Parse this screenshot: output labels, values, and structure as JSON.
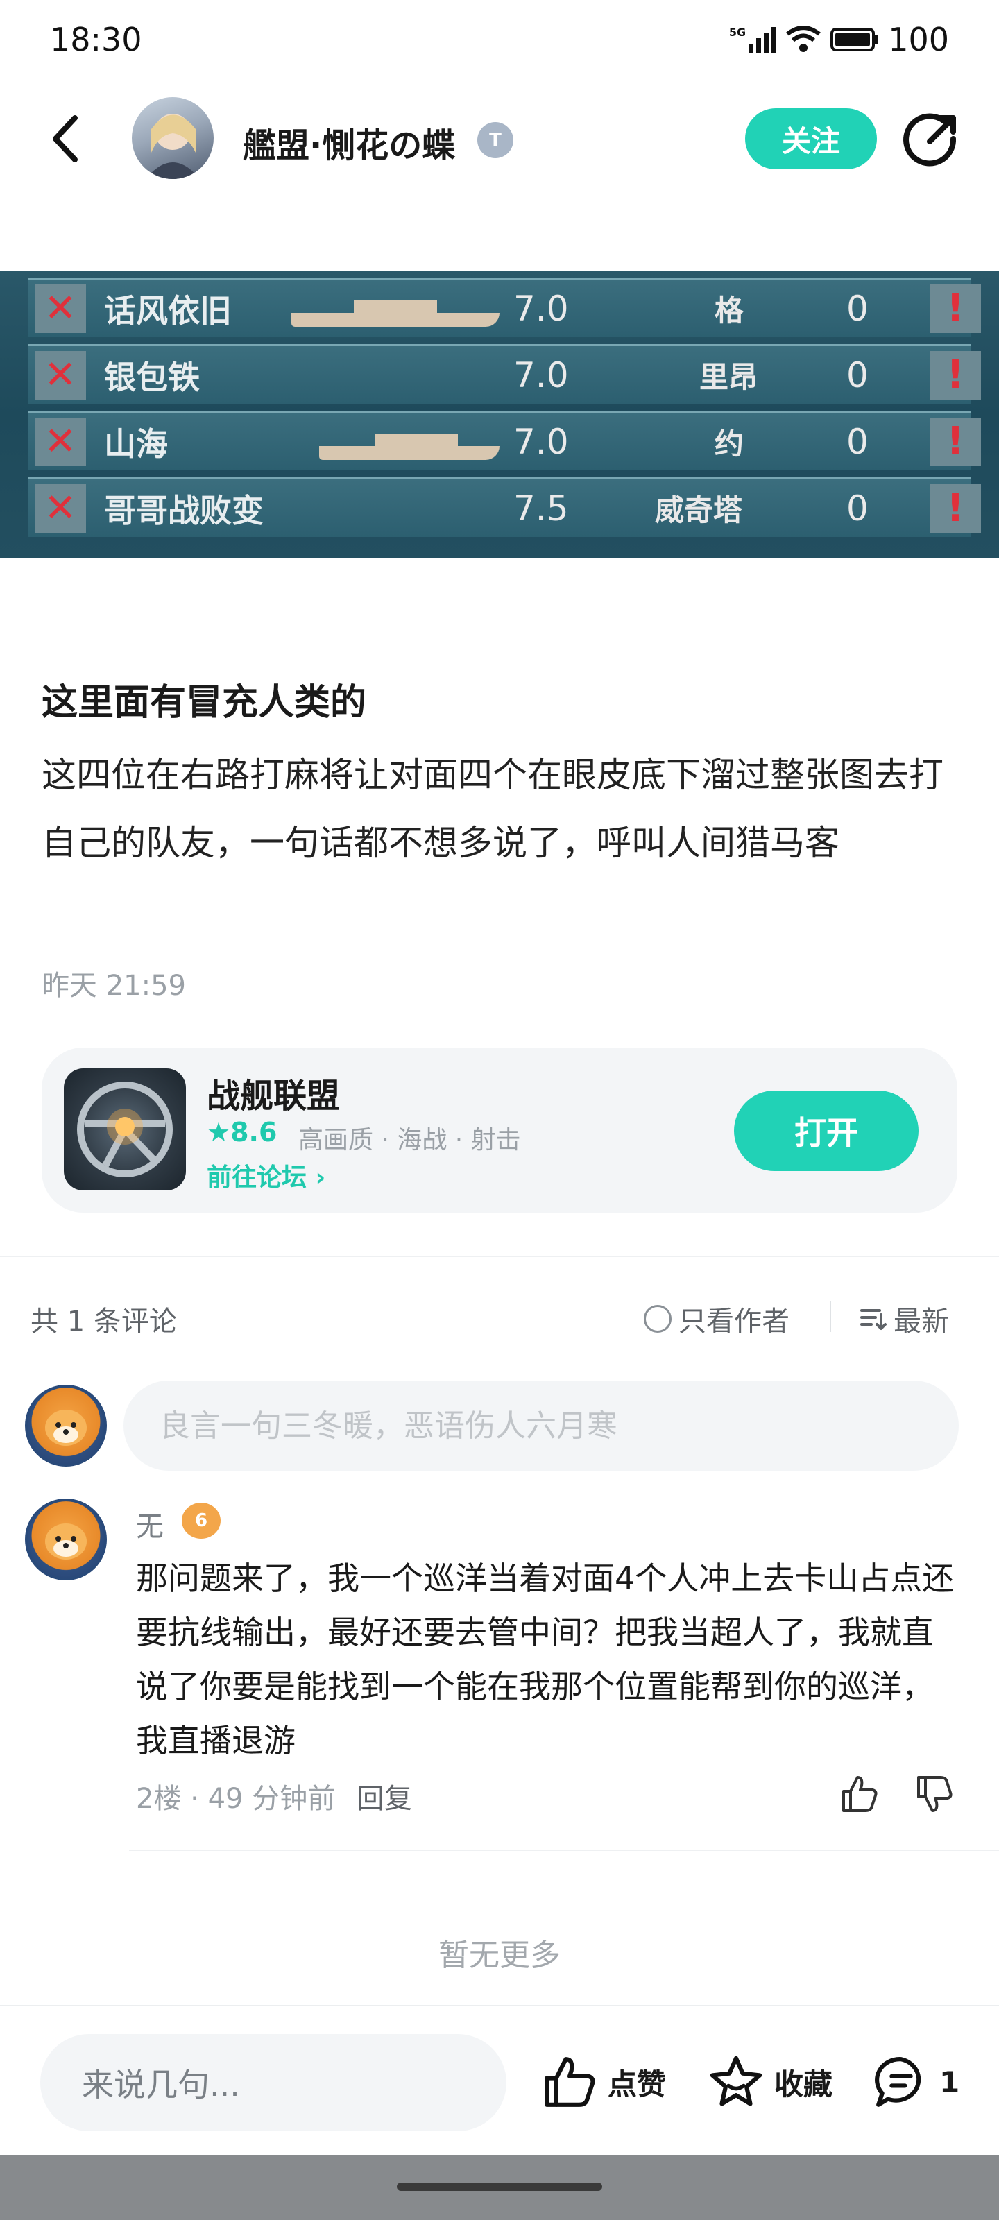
{
  "status_bar": {
    "time": "18:30",
    "network": "5G",
    "battery": "100"
  },
  "header": {
    "author": "艦盟·惻花の蝶",
    "verified_badge": "T",
    "follow_label": "关注"
  },
  "banner": {
    "rows": [
      {
        "player": "话风依旧",
        "score": "7.0",
        "enemy": "格",
        "kills": "0"
      },
      {
        "player": "银包铁",
        "score": "7.0",
        "enemy": "里昂",
        "kills": "0"
      },
      {
        "player": "山海",
        "score": "7.0",
        "enemy": "约",
        "kills": "0"
      },
      {
        "player": "哥哥战败变",
        "score": "7.5",
        "enemy": "威奇塔",
        "kills": "0"
      }
    ]
  },
  "post": {
    "title": "这里面有冒充人类的",
    "body": "这四位在右路打麻将让对面四个在眼皮底下溜过整张图去打自己的队友，一句话都不想多说了，呼叫人间猎马客",
    "time": "昨天 21:59"
  },
  "game_card": {
    "name": "战舰联盟",
    "rating": "★8.6",
    "tags": "高画质 · 海战 · 射击",
    "forum_link": "前往论坛 ›",
    "open_label": "打开"
  },
  "comments_header": {
    "count": "共 1 条评论",
    "only_author": "只看作者",
    "sort": "最新"
  },
  "comment_input": {
    "placeholder": "良言一句三冬暖，恶语伤人六月寒"
  },
  "comments": [
    {
      "name": "无",
      "badge": "6",
      "text": "那问题来了，我一个巡洋当着对面4个人冲上去卡山占点还要抗线输出，最好还要去管中间？把我当超人了，我就直说了你要是能找到一个能在我那个位置能帮到你的巡洋，我直播退游",
      "meta": "2楼 · 49 分钟前",
      "reply_label": "回复"
    }
  ],
  "no_more": "暂无更多",
  "bottom_bar": {
    "input_placeholder": "来说几句...",
    "like_label": "点赞",
    "fav_label": "收藏",
    "comment_count": "1"
  }
}
